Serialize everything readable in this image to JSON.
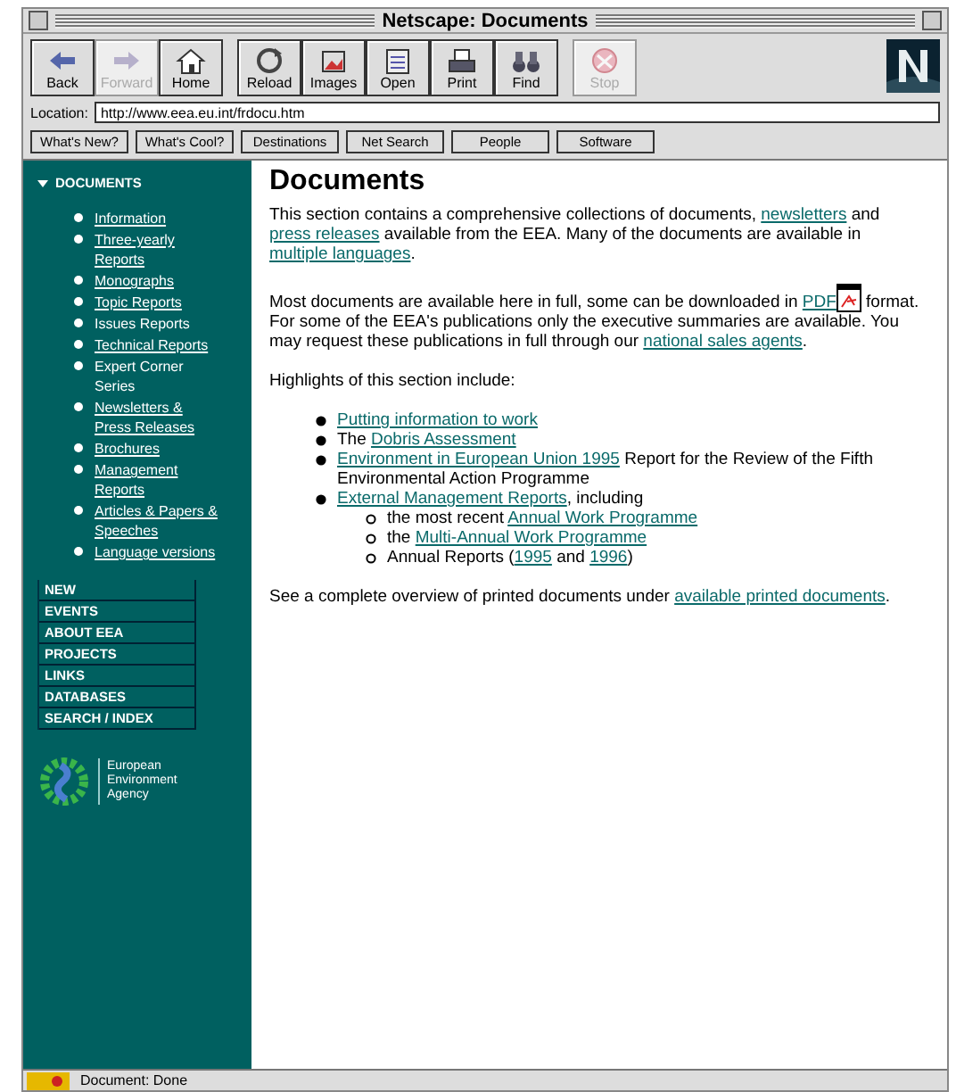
{
  "window": {
    "title": "Netscape: Documents"
  },
  "toolbar": [
    {
      "label": "Back",
      "disabled": false
    },
    {
      "label": "Forward",
      "disabled": true
    },
    {
      "label": "Home",
      "disabled": false
    },
    {
      "label": "Reload",
      "disabled": false,
      "group_start": true
    },
    {
      "label": "Images",
      "disabled": false
    },
    {
      "label": "Open",
      "disabled": false
    },
    {
      "label": "Print",
      "disabled": false
    },
    {
      "label": "Find",
      "disabled": false
    },
    {
      "label": "Stop",
      "disabled": true,
      "group_start": true
    }
  ],
  "location": {
    "label": "Location:",
    "value": "http://www.eea.eu.int/frdocu.htm"
  },
  "directory_buttons": [
    "What's New?",
    "What's Cool?",
    "Destinations",
    "Net Search",
    "People",
    "Software"
  ],
  "sidebar": {
    "heading": "DOCUMENTS",
    "items": [
      {
        "text": "Information",
        "link": true
      },
      {
        "text": "Three-yearly Reports",
        "link": true
      },
      {
        "text": "Monographs",
        "link": true
      },
      {
        "text": "Topic Reports",
        "link": true
      },
      {
        "text": "Issues Reports",
        "link": false
      },
      {
        "text": "Technical Reports",
        "link": true
      },
      {
        "text": "Expert Corner Series",
        "link": false
      },
      {
        "text": "Newsletters & Press Releases",
        "link": true
      },
      {
        "text": "Brochures",
        "link": true
      },
      {
        "text": "Management Reports",
        "link": true
      },
      {
        "text": "Articles & Papers & Speeches",
        "link": true
      },
      {
        "text": "Language versions",
        "link": true
      }
    ],
    "nav": [
      "NEW",
      "EVENTS",
      "ABOUT EEA",
      "PROJECTS",
      "LINKS",
      "DATABASES",
      "SEARCH / INDEX"
    ],
    "logo_text": "European Environment Agency"
  },
  "content": {
    "heading": "Documents",
    "paragraphs": [
      [
        {
          "text": "This section contains a comprehensive collections of documents, ",
          "link": false
        },
        {
          "text": "newsletters",
          "link": true
        },
        {
          "text": " and ",
          "link": false
        },
        {
          "text": "press releases",
          "link": true
        },
        {
          "text": " available from the EEA. Many of the documents are available in ",
          "link": false
        },
        {
          "text": "multiple languages",
          "link": true
        },
        {
          "text": ".",
          "link": false
        }
      ],
      [
        {
          "text": "Most documents are available here in full, some can be downloaded in ",
          "link": false
        },
        {
          "text": "PDF",
          "link": true
        },
        {
          "kind": "pdf-icon"
        },
        {
          "text": " format. For some of the EEA's publications only the executive summaries are available. You may request these publications in full through our ",
          "link": false
        },
        {
          "text": "national sales agents",
          "link": true
        },
        {
          "text": ".",
          "link": false
        }
      ],
      [
        {
          "text": "Highlights of this section include:",
          "link": false
        }
      ]
    ],
    "highlights": [
      {
        "segments": [
          {
            "text": "Putting information to work",
            "link": true
          }
        ]
      },
      {
        "segments": [
          {
            "text": "The ",
            "link": false
          },
          {
            "text": "Dobris Assessment",
            "link": true
          }
        ]
      },
      {
        "segments": [
          {
            "text": "Environment in European Union 1995",
            "link": true
          },
          {
            "text": " Report for the Review of the Fifth Environmental Action Programme",
            "link": false
          }
        ]
      },
      {
        "segments": [
          {
            "text": "External Management Reports",
            "link": true
          },
          {
            "text": ", including",
            "link": false
          }
        ],
        "children": [
          {
            "segments": [
              {
                "text": "the most recent ",
                "link": false
              },
              {
                "text": "Annual Work Programme",
                "link": true
              }
            ]
          },
          {
            "segments": [
              {
                "text": "the ",
                "link": false
              },
              {
                "text": "Multi-Annual Work Programme",
                "link": true
              }
            ]
          },
          {
            "segments": [
              {
                "text": "Annual Reports (",
                "link": false
              },
              {
                "text": "1995",
                "link": true
              },
              {
                "text": " and ",
                "link": false
              },
              {
                "text": "1996",
                "link": true
              },
              {
                "text": ")",
                "link": false
              }
            ]
          }
        ]
      }
    ],
    "closing": [
      {
        "text": "See a complete overview of printed documents under ",
        "link": false
      },
      {
        "text": "available printed documents",
        "link": true
      },
      {
        "text": ".",
        "link": false
      }
    ]
  },
  "status_bar": {
    "text": "Document: Done"
  }
}
